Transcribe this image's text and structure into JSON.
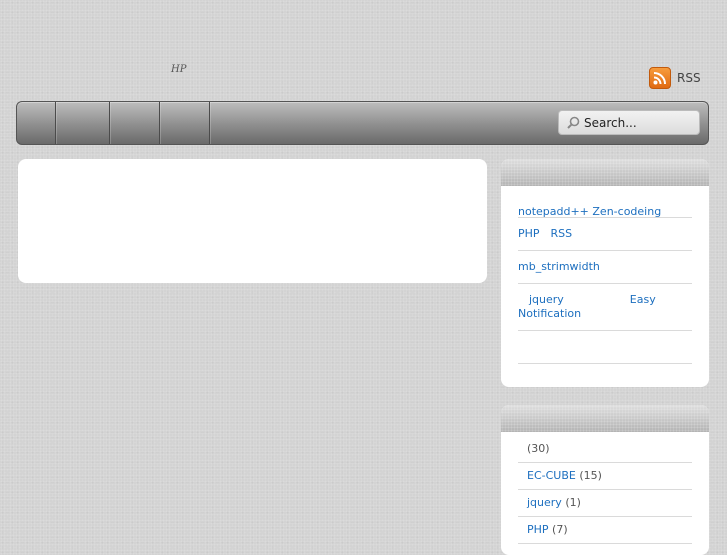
{
  "header": {
    "tagline": "HP",
    "rss_label": "RSS"
  },
  "navbar": {
    "items": [
      "",
      "",
      "",
      ""
    ],
    "search": {
      "placeholder": "Search..."
    }
  },
  "recent_posts": {
    "title": "",
    "items": [
      "notepadd++ Zen-codeing",
      "PHP　RSS",
      "mb_strimwidth",
      "　jquery　　　　　　Easy Notification",
      ""
    ]
  },
  "categories": {
    "title": "",
    "items": [
      {
        "name": "",
        "count": "(30)"
      },
      {
        "name": "EC-CUBE",
        "count": "(15)"
      },
      {
        "name": "jquery",
        "count": "(1)"
      },
      {
        "name": "PHP",
        "count": "(7)"
      }
    ]
  },
  "colors": {
    "background": "#d3d3d3",
    "link": "#1d6fbf",
    "rss": "#f08a24"
  }
}
